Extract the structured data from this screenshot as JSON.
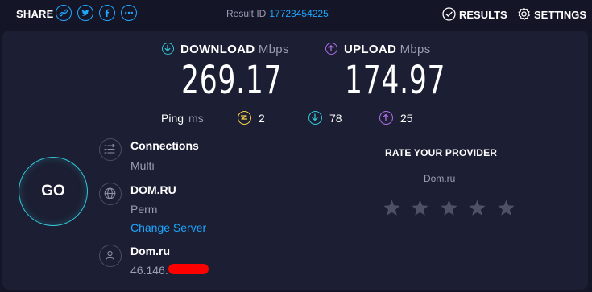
{
  "header": {
    "share_label": "SHARE",
    "share_icons": [
      "link-icon",
      "twitter-icon",
      "facebook-icon",
      "more-icon"
    ],
    "result_id_label": "Result ID",
    "result_id": "17723454225",
    "results_label": "RESULTS",
    "settings_label": "SETTINGS"
  },
  "download": {
    "label": "DOWNLOAD",
    "unit": "Mbps",
    "value": "269.17",
    "color": "#31c7d4"
  },
  "upload": {
    "label": "UPLOAD",
    "unit": "Mbps",
    "value": "174.97",
    "color": "#b06ee8"
  },
  "ping": {
    "label": "Ping",
    "unit": "ms",
    "idle": "2",
    "download": "78",
    "upload": "25",
    "idle_color": "#f5d04a"
  },
  "go_label": "GO",
  "connections": {
    "title": "Connections",
    "value": "Multi"
  },
  "server": {
    "title": "DOM.RU",
    "location": "Perm",
    "change_label": "Change Server"
  },
  "provider": {
    "title": "Dom.ru",
    "ip": "46.146."
  },
  "rating": {
    "title": "RATE YOUR PROVIDER",
    "provider": "Dom.ru",
    "stars_total": 5,
    "stars_filled": 0
  },
  "colors": {
    "accent": "#1ea7ff",
    "background": "#141526",
    "card": "#1c1e33",
    "muted": "#9b9db3",
    "star": "#4d5066"
  }
}
